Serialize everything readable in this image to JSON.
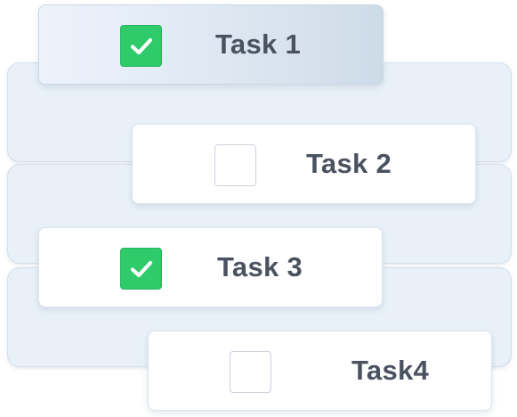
{
  "tasks": [
    {
      "label": "Task 1",
      "checked": true,
      "highlighted": true
    },
    {
      "label": "Task 2",
      "checked": false,
      "highlighted": false
    },
    {
      "label": "Task 3",
      "checked": true,
      "highlighted": false
    },
    {
      "label": "Task4",
      "checked": false,
      "highlighted": false
    }
  ],
  "colors": {
    "check_green": "#2fcb6b",
    "label_text": "#4a5260",
    "panel_bg": "#e9f0f8"
  },
  "icons": {
    "checked": "checkmark-icon"
  }
}
